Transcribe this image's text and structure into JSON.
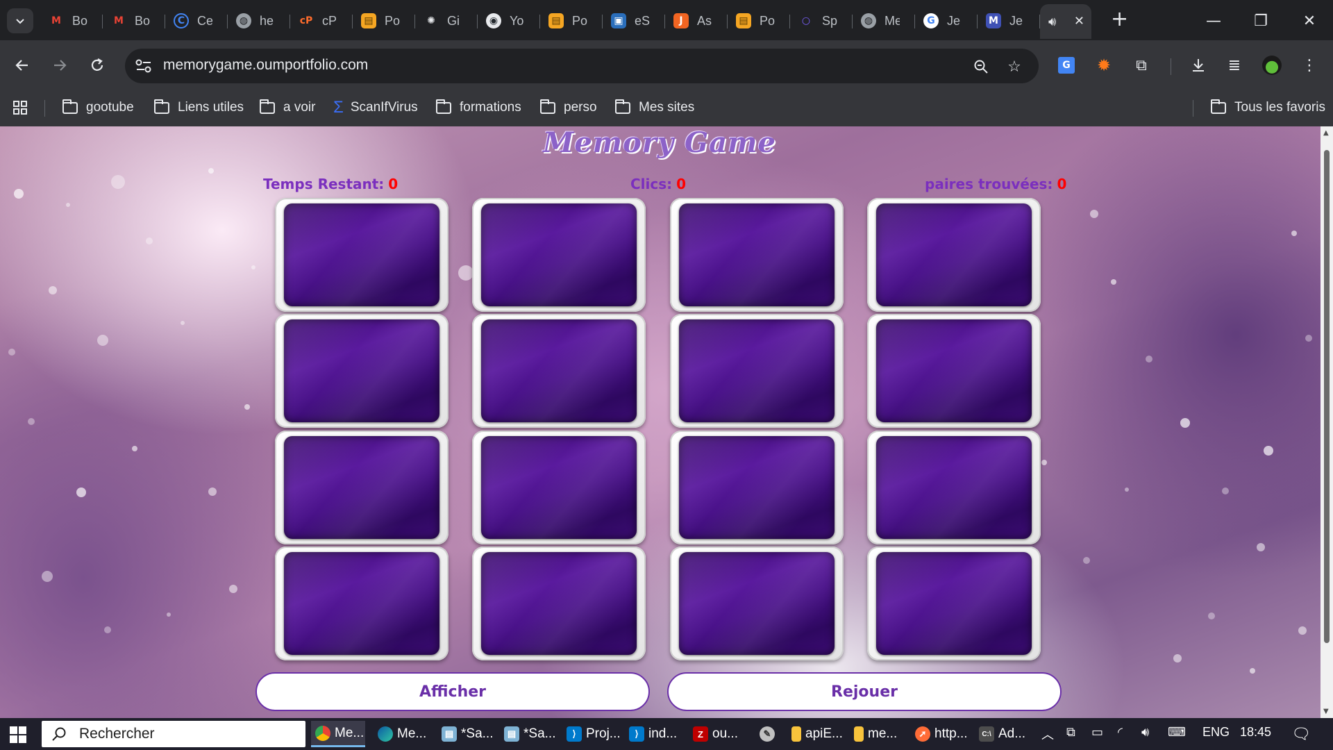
{
  "browser": {
    "tabs": [
      {
        "title": "Bo",
        "icon": "gmail-icon",
        "color": "#ea4335",
        "glyph": "M"
      },
      {
        "title": "Bo",
        "icon": "gmail-icon",
        "color": "#ea4335",
        "glyph": "M"
      },
      {
        "title": "Ce",
        "icon": "ce-icon",
        "color": "#4285f4",
        "glyph": "C"
      },
      {
        "title": "he",
        "icon": "globe-icon",
        "color": "#9aa0a6",
        "glyph": "◍"
      },
      {
        "title": "cP",
        "icon": "cpanel-icon",
        "color": "#ff6c2c",
        "glyph": "c"
      },
      {
        "title": "Po",
        "icon": "folder-orange-icon",
        "color": "#f5a623",
        "glyph": "▤"
      },
      {
        "title": "Gi",
        "icon": "openai-icon",
        "color": "#5f6368",
        "glyph": "✺"
      },
      {
        "title": "Yo",
        "icon": "github-icon",
        "color": "#24292e",
        "glyph": "◉"
      },
      {
        "title": "Po",
        "icon": "folder-orange-icon",
        "color": "#f5a623",
        "glyph": "▤"
      },
      {
        "title": "eS",
        "icon": "shop-icon",
        "color": "#2a6ebb",
        "glyph": "▣"
      },
      {
        "title": "As",
        "icon": "aspose-icon",
        "color": "#f26522",
        "glyph": "J"
      },
      {
        "title": "Po",
        "icon": "folder-orange-icon",
        "color": "#f5a623",
        "glyph": "▤"
      },
      {
        "title": "Sp",
        "icon": "spline-icon",
        "color": "#7b61ff",
        "glyph": "○"
      },
      {
        "title": "Me",
        "icon": "globe-icon",
        "color": "#9aa0a6",
        "glyph": "◍"
      },
      {
        "title": "Je",
        "icon": "google-icon",
        "color": "#ffffff",
        "glyph": "G"
      },
      {
        "title": "Je",
        "icon": "m-icon",
        "color": "#3f51b5",
        "glyph": "M"
      }
    ],
    "url": "memorygame.oumportfolio.com",
    "bookmarks": [
      {
        "label": "gootube",
        "icon": "folder-icon"
      },
      {
        "label": "Liens utiles",
        "icon": "folder-icon"
      },
      {
        "label": "a voir",
        "icon": "folder-icon"
      },
      {
        "label": "ScanIfVirus",
        "icon": "scan-icon"
      },
      {
        "label": "formations",
        "icon": "folder-icon"
      },
      {
        "label": "perso",
        "icon": "folder-icon"
      },
      {
        "label": "Mes sites",
        "icon": "folder-icon"
      }
    ],
    "all_bookmarks": "Tous les favoris"
  },
  "game": {
    "title": "Memory Game",
    "time_label": "Temps Restant:",
    "time_value": "0",
    "clicks_label": "Clics:",
    "clicks_value": "0",
    "pairs_label": "paires trouvées:",
    "pairs_value": "0",
    "show_button": "Afficher",
    "replay_button": "Rejouer",
    "colors": {
      "label": "#7b2fbe",
      "value": "#ff0000",
      "card_back": "#4a128a"
    }
  },
  "taskbar": {
    "search_placeholder": "Rechercher",
    "apps": [
      {
        "label": "Me...",
        "icon": "chrome-icon",
        "color": "#fbbc05",
        "active": true
      },
      {
        "label": "Me...",
        "icon": "edge-icon",
        "color": "#1e9bd7"
      },
      {
        "label": "*Sa...",
        "icon": "notepad-icon",
        "color": "#7fb3d5"
      },
      {
        "label": "*Sa...",
        "icon": "notepad-icon",
        "color": "#7fb3d5"
      },
      {
        "label": "Proj...",
        "icon": "vscode-icon",
        "color": "#007acc"
      },
      {
        "label": "ind...",
        "icon": "vscode-icon",
        "color": "#007acc"
      },
      {
        "label": "ou...",
        "icon": "filezilla-icon",
        "color": "#bf0000"
      },
      {
        "label": "",
        "icon": "paint-icon",
        "color": "#c0c0c0"
      },
      {
        "label": "apiE...",
        "icon": "file-explorer-icon",
        "color": "#f8c33c"
      },
      {
        "label": "me...",
        "icon": "file-explorer-icon",
        "color": "#f8c33c"
      },
      {
        "label": "http...",
        "icon": "postman-icon",
        "color": "#ff6c37"
      },
      {
        "label": "Ad...",
        "icon": "terminal-icon",
        "color": "#4d4d4d"
      }
    ],
    "lang": "ENG",
    "time": "18:45"
  }
}
